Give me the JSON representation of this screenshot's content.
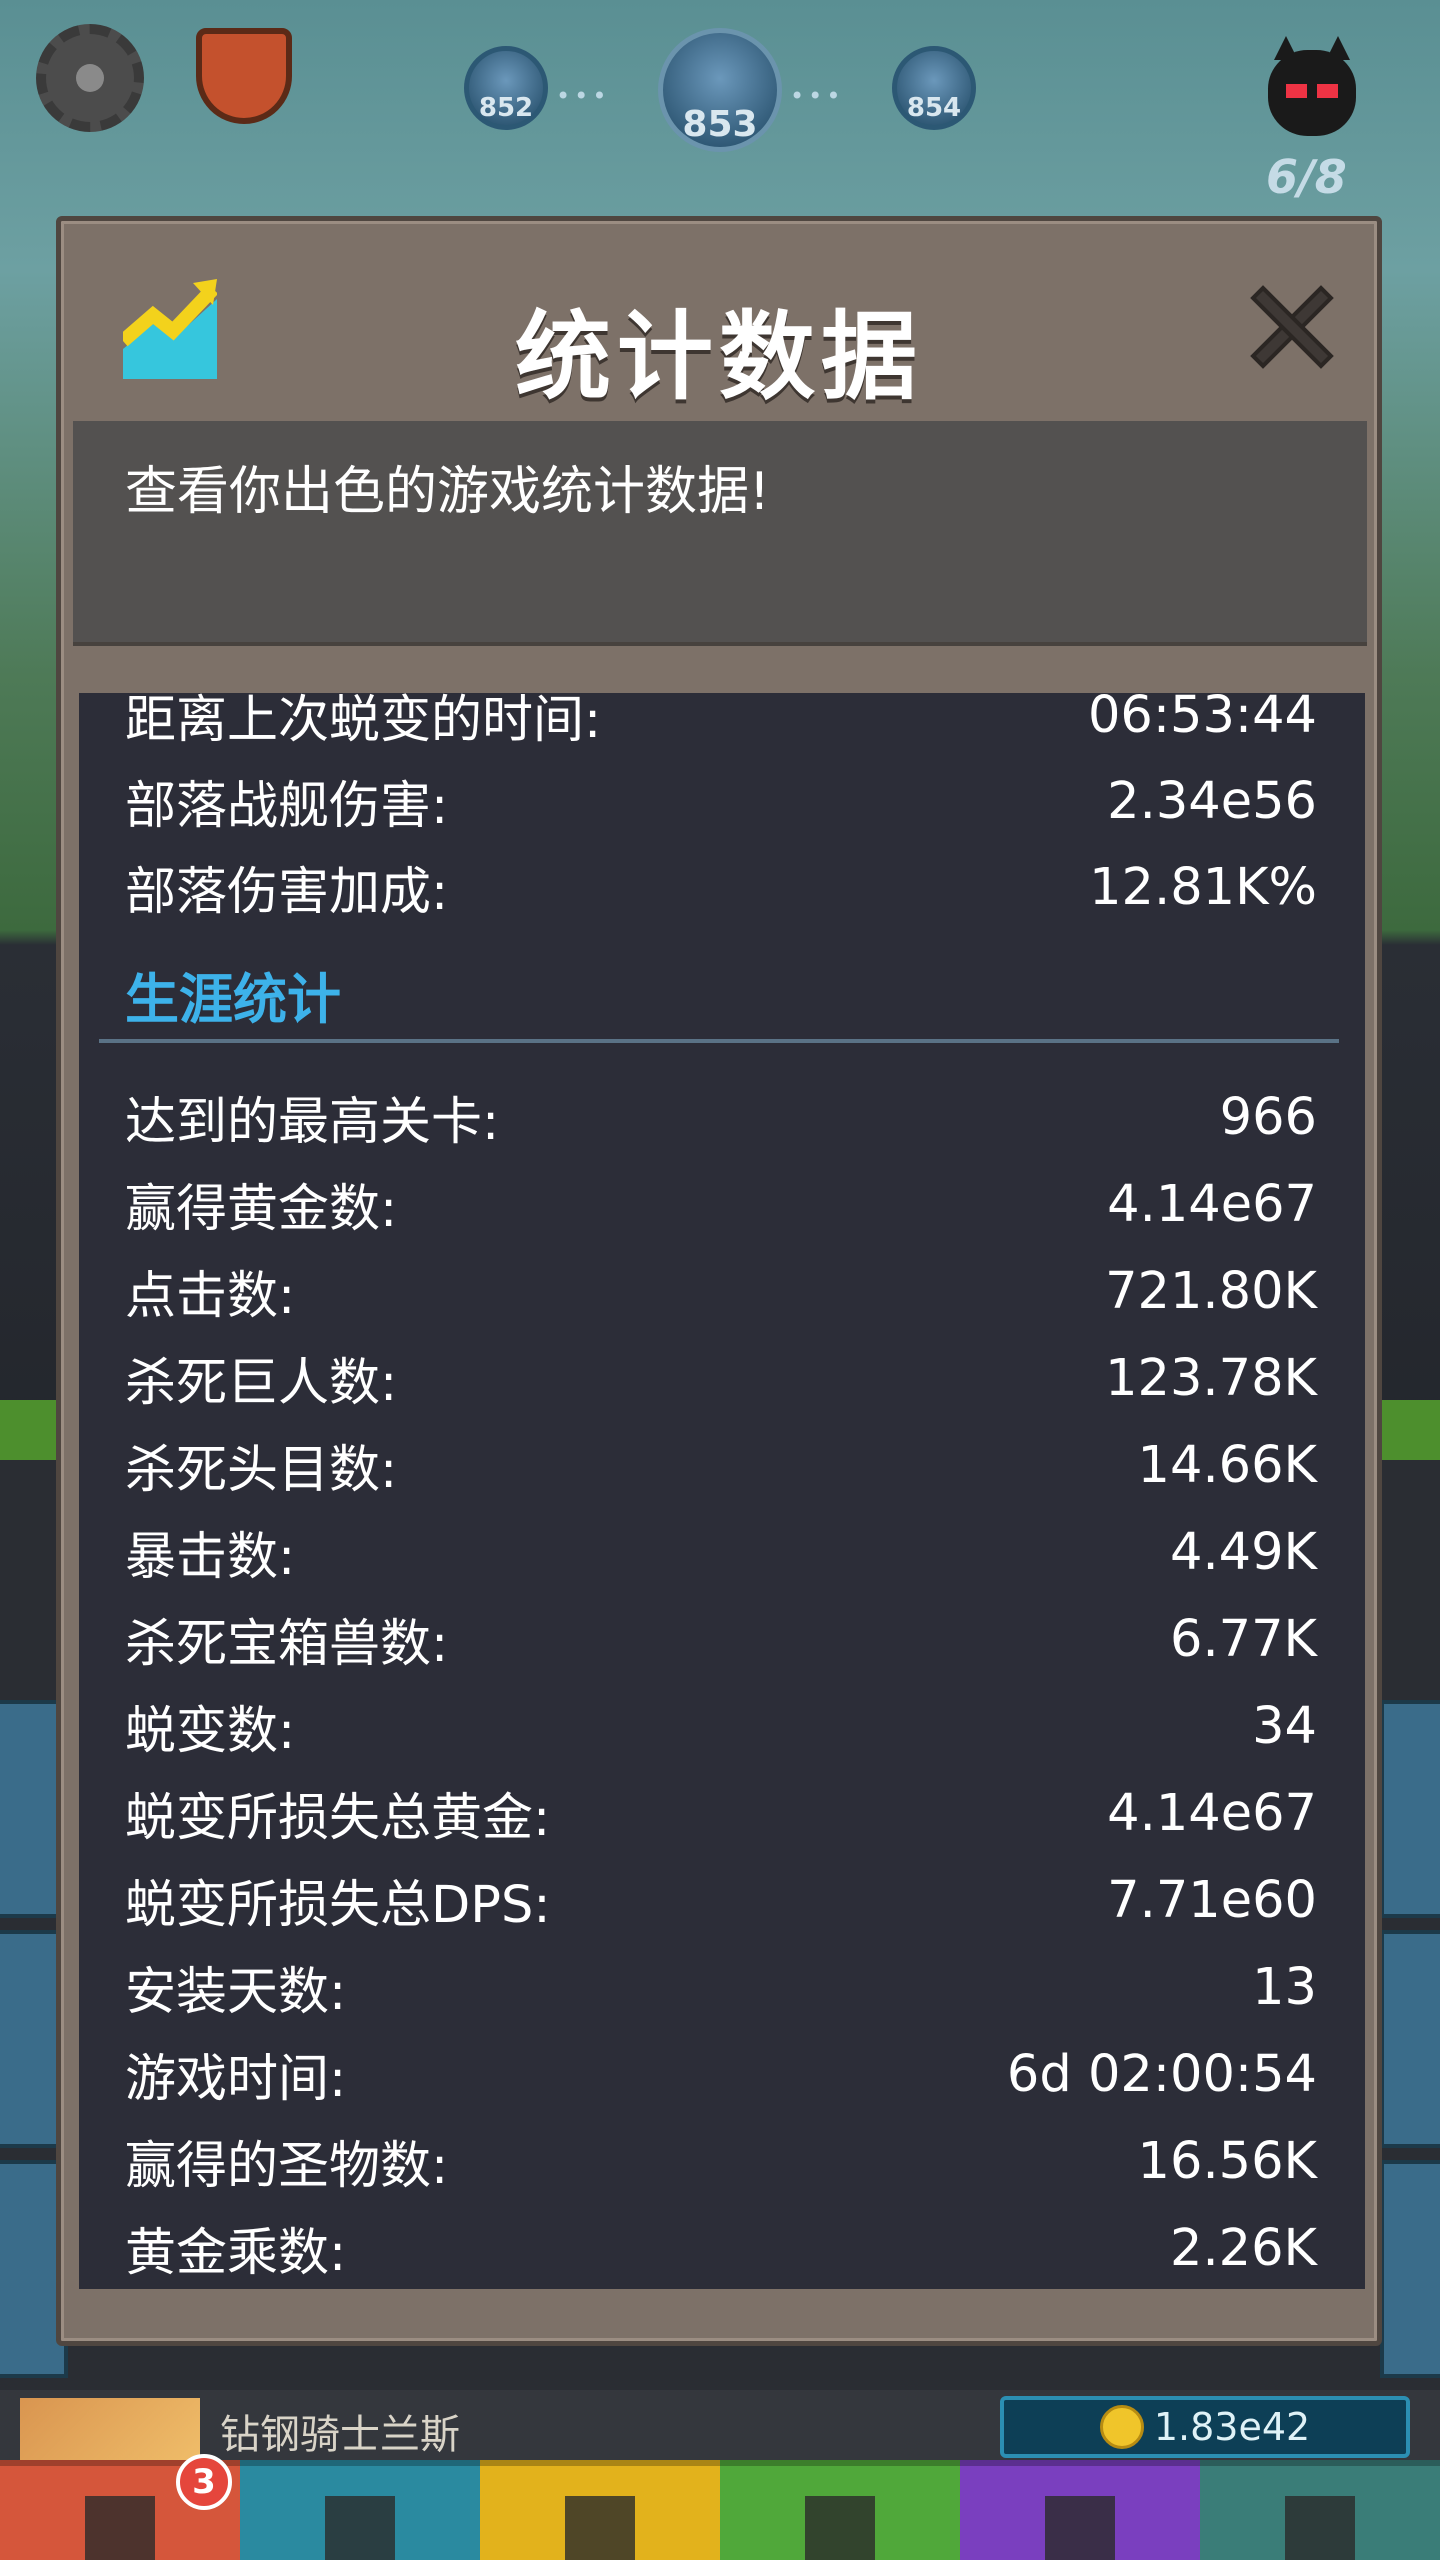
{
  "hud": {
    "stages": [
      "852",
      "853",
      "854"
    ],
    "boss_counter": "6/8"
  },
  "dialog": {
    "title": "统计数据",
    "description": "查看你出色的游戏统计数据!",
    "clan_stats": [
      {
        "label": "距离上次蜕变的时间:",
        "value": "06:53:44"
      },
      {
        "label": "部落战舰伤害:",
        "value": "2.34e56"
      },
      {
        "label": "部落伤害加成:",
        "value": "12.81K%"
      }
    ],
    "career_title": "生涯统计",
    "career_stats": [
      {
        "label": "达到的最高关卡:",
        "value": "966"
      },
      {
        "label": "赢得黄金数:",
        "value": "4.14e67"
      },
      {
        "label": "点击数:",
        "value": "721.80K"
      },
      {
        "label": "杀死巨人数:",
        "value": "123.78K"
      },
      {
        "label": "杀死头目数:",
        "value": "14.66K"
      },
      {
        "label": "暴击数:",
        "value": "4.49K"
      },
      {
        "label": "杀死宝箱兽数:",
        "value": "6.77K"
      },
      {
        "label": "蜕变数:",
        "value": "34"
      },
      {
        "label": "蜕变所损失总黄金:",
        "value": "4.14e67"
      },
      {
        "label": "蜕变所损失总DPS:",
        "value": "7.71e60"
      },
      {
        "label": "安装天数:",
        "value": "13"
      },
      {
        "label": "游戏时间:",
        "value": "6d 02:00:54"
      },
      {
        "label": "赢得的圣物数:",
        "value": "16.56K"
      },
      {
        "label": "黄金乘数:",
        "value": "2.26K"
      }
    ]
  },
  "background_hero": {
    "name": "钻钢骑士兰斯",
    "gold": "1.83e42"
  },
  "tabbar": {
    "badge": "3"
  },
  "colors": {
    "dialog_frame": "#7d7168",
    "stats_bg": "#2c2d38",
    "section_accent": "#3db2ea"
  }
}
